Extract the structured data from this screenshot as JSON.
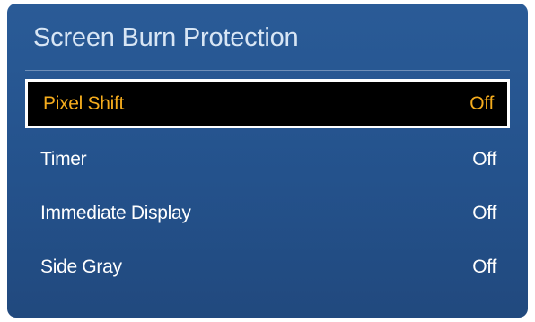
{
  "title": "Screen Burn Protection",
  "menu": {
    "items": [
      {
        "label": "Pixel Shift",
        "value": "Off",
        "selected": true
      },
      {
        "label": "Timer",
        "value": "Off",
        "selected": false
      },
      {
        "label": "Immediate Display",
        "value": "Off",
        "selected": false
      },
      {
        "label": "Side Gray",
        "value": "Off",
        "selected": false
      }
    ]
  },
  "colors": {
    "panel_background": "#25548f",
    "selected_text": "#f5ac1d",
    "selected_background": "#000000",
    "normal_text": "#ffffff",
    "title_text": "#d8e6f5"
  }
}
